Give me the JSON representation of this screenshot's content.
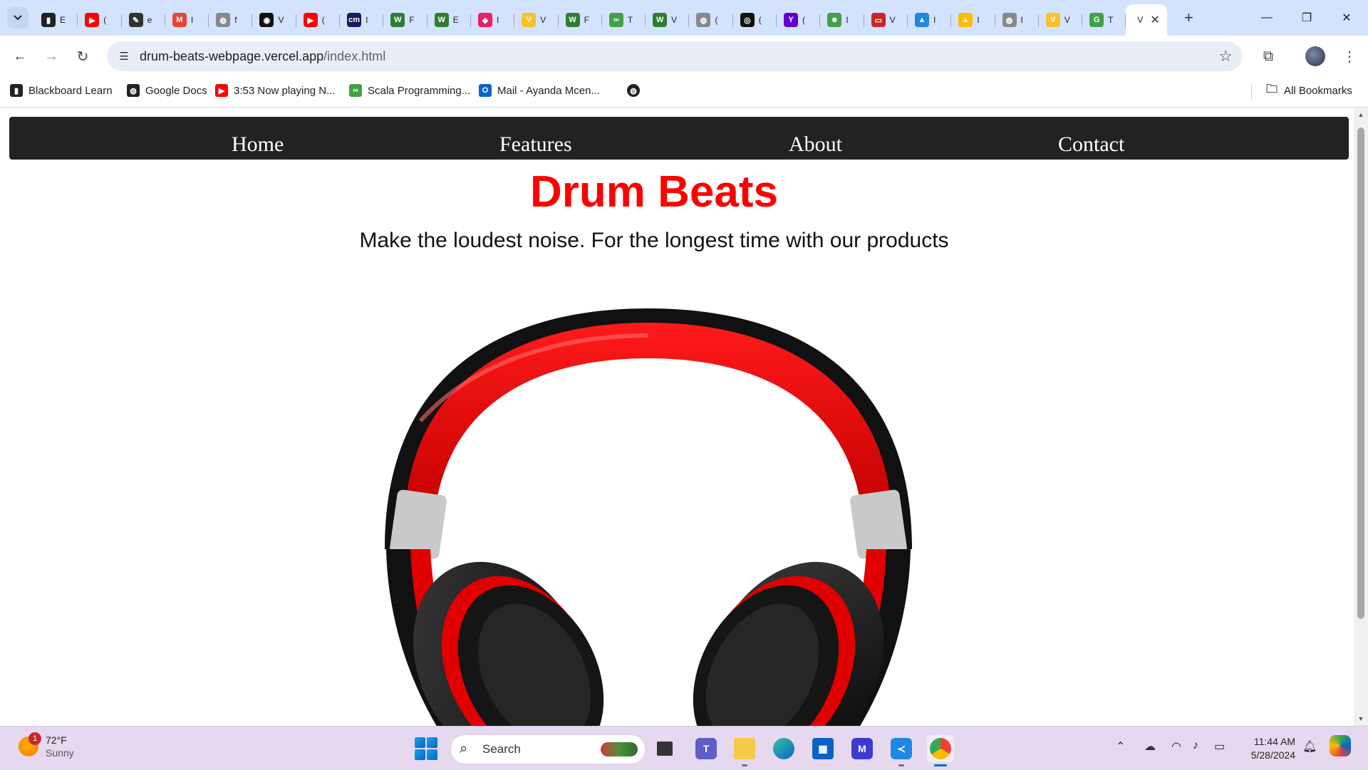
{
  "browser": {
    "tabs": [
      {
        "glyph": "▮",
        "color": "#222",
        "title": "E"
      },
      {
        "glyph": "▶",
        "color": "#ff0000",
        "title": "("
      },
      {
        "glyph": "✎",
        "color": "#333",
        "title": "e"
      },
      {
        "glyph": "M",
        "color": "#ea4335",
        "title": "I"
      },
      {
        "glyph": "◍",
        "color": "#888",
        "title": "f"
      },
      {
        "glyph": "◉",
        "color": "#111",
        "title": "V"
      },
      {
        "glyph": "▶",
        "color": "#ff0000",
        "title": "("
      },
      {
        "glyph": "cm",
        "color": "#1a1a5e",
        "title": "I"
      },
      {
        "glyph": "W",
        "color": "#2e7d32",
        "title": "F"
      },
      {
        "glyph": "W",
        "color": "#2e7d32",
        "title": "E"
      },
      {
        "glyph": "◆",
        "color": "#e91e63",
        "title": "I"
      },
      {
        "glyph": "V",
        "color": "#fbc02d",
        "title": "V"
      },
      {
        "glyph": "W",
        "color": "#2e7d32",
        "title": "F"
      },
      {
        "glyph": "∞",
        "color": "#43a047",
        "title": "T"
      },
      {
        "glyph": "W",
        "color": "#2e7d32",
        "title": "V"
      },
      {
        "glyph": "◍",
        "color": "#888",
        "title": "("
      },
      {
        "glyph": "◎",
        "color": "#111",
        "title": "("
      },
      {
        "glyph": "Y",
        "color": "#6001d2",
        "title": "("
      },
      {
        "glyph": "☻",
        "color": "#43a047",
        "title": "I"
      },
      {
        "glyph": "▭",
        "color": "#c62828",
        "title": "V"
      },
      {
        "glyph": "▲",
        "color": "#1e88e5",
        "title": "I"
      },
      {
        "glyph": "▲",
        "color": "#fbbc04",
        "title": "I"
      },
      {
        "glyph": "◍",
        "color": "#888",
        "title": "I"
      },
      {
        "glyph": "V",
        "color": "#fbc02d",
        "title": "V"
      },
      {
        "glyph": "G",
        "color": "#43a047",
        "title": "T"
      }
    ],
    "active_tab_title": "V",
    "url_host": "drum-beats-webpage.vercel.app",
    "url_path": "/index.html",
    "bookmarks": [
      {
        "label": "Blackboard Learn",
        "color": "#222",
        "glyph": "▮"
      },
      {
        "label": "Google Docs",
        "color": "#222",
        "glyph": "◍"
      },
      {
        "label": "3:53 Now playing N...",
        "color": "#ff0000",
        "glyph": "▶"
      },
      {
        "label": "Scala Programming...",
        "color": "#43a047",
        "glyph": "∞"
      },
      {
        "label": "Mail - Ayanda Mcen...",
        "color": "#0a64c8",
        "glyph": "O"
      }
    ],
    "all_bookmarks": "All Bookmarks"
  },
  "site": {
    "nav": [
      "Home",
      "Features",
      "About",
      "Contact"
    ],
    "title": "Drum Beats",
    "subtitle": "Make the loudest noise. For the longest time with our products",
    "colors": {
      "title": "#ff0000",
      "nav_bg": "#222222"
    }
  },
  "taskbar": {
    "weather_temp": "72°F",
    "weather_cond": "Sunny",
    "weather_badge": "1",
    "search_label": "Search",
    "time": "11:44 AM",
    "date": "5/28/2024"
  }
}
